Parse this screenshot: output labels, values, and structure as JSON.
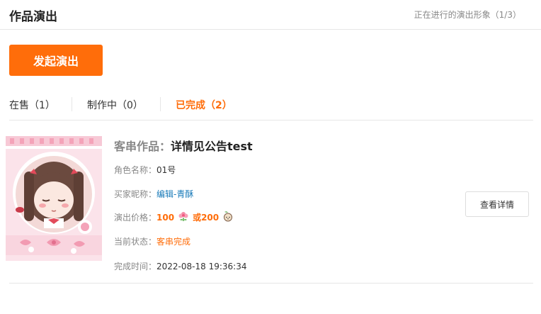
{
  "header": {
    "title": "作品演出",
    "status_text": "正在进行的演出形象（1/3）"
  },
  "launch_button": {
    "label": "发起演出"
  },
  "tabs": [
    {
      "label": "在售（1）",
      "active": false
    },
    {
      "label": "制作中（0）",
      "active": false
    },
    {
      "label": "已完成（2）",
      "active": true
    }
  ],
  "card": {
    "title_prefix": "客串作品：",
    "title": "详情见公告test",
    "role_label": "角色名称：",
    "role_value": "01号",
    "buyer_label": "买家昵称：",
    "buyer_value": "编辑-青酥",
    "price_label": "演出价格：",
    "price_primary": "100",
    "price_primary_icon": "flower-icon",
    "price_or": "或200",
    "price_alt_icon": "peach-icon",
    "status_label": "当前状态：",
    "status_value": "客串完成",
    "time_label": "完成时间：",
    "time_value": "2022-08-18 19:36:34",
    "detail_button": "查看详情"
  },
  "colors": {
    "accent": "#ff6d0a",
    "link": "#1a7bb9",
    "muted": "#888888",
    "divider": "#e6e6e6"
  }
}
